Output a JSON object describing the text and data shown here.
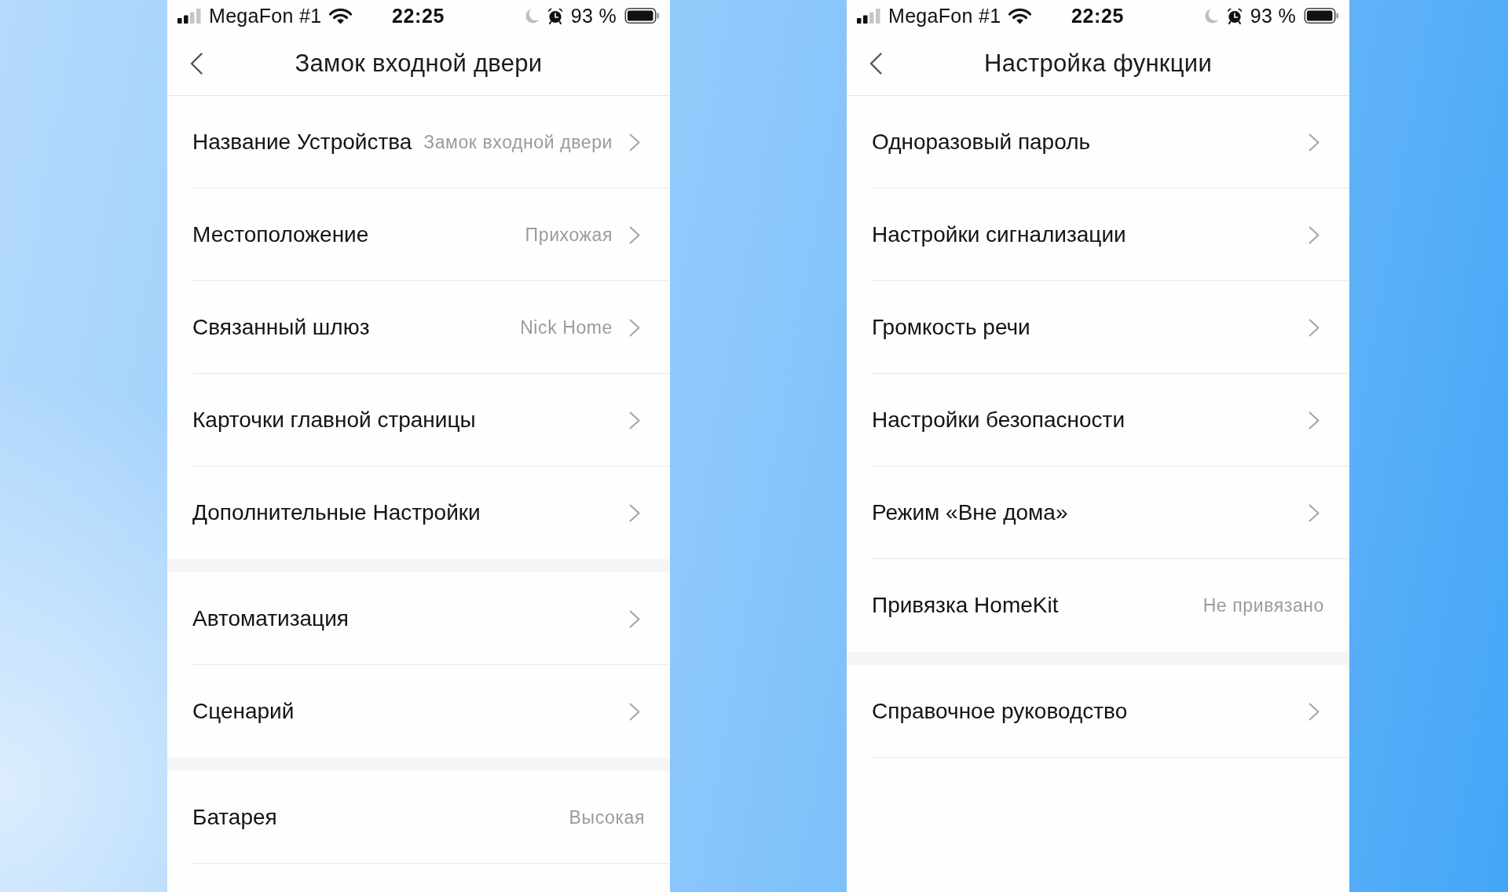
{
  "screens": [
    {
      "status_bar": {
        "carrier": "MegaFon #1",
        "time": "22:25",
        "battery": "93 %"
      },
      "title": "Замок входной двери",
      "groups": [
        {
          "items": [
            {
              "kind": "link",
              "label": "Название Устройства",
              "value": "Замок входной двери"
            },
            {
              "kind": "link",
              "label": "Местоположение",
              "value": "Прихожая"
            },
            {
              "kind": "link",
              "label": "Связанный шлюз",
              "value": "Nick Home"
            },
            {
              "kind": "link",
              "label": "Карточки главной страницы"
            },
            {
              "kind": "link",
              "label": "Дополнительные Настройки"
            }
          ]
        },
        {
          "items": [
            {
              "kind": "link",
              "label": "Автоматизация"
            },
            {
              "kind": "link",
              "label": "Сценарий"
            }
          ]
        },
        {
          "items": [
            {
              "kind": "info",
              "label": "Батарея",
              "value": "Высокая"
            }
          ]
        }
      ]
    },
    {
      "status_bar": {
        "carrier": "MegaFon #1",
        "time": "22:25",
        "battery": "93 %"
      },
      "title": "Настройка функции",
      "groups": [
        {
          "items": [
            {
              "kind": "link",
              "label": "Одноразовый пароль"
            },
            {
              "kind": "link",
              "label": "Настройки сигнализации"
            },
            {
              "kind": "link",
              "label": "Громкость речи"
            },
            {
              "kind": "link",
              "label": "Настройки безопасности"
            },
            {
              "kind": "link",
              "label": "Режим «Вне дома»"
            },
            {
              "kind": "info",
              "label": "Привязка HomeKit",
              "value": "Не привязано"
            }
          ]
        },
        {
          "items": [
            {
              "kind": "link",
              "label": "Справочное руководство"
            }
          ]
        }
      ]
    }
  ]
}
